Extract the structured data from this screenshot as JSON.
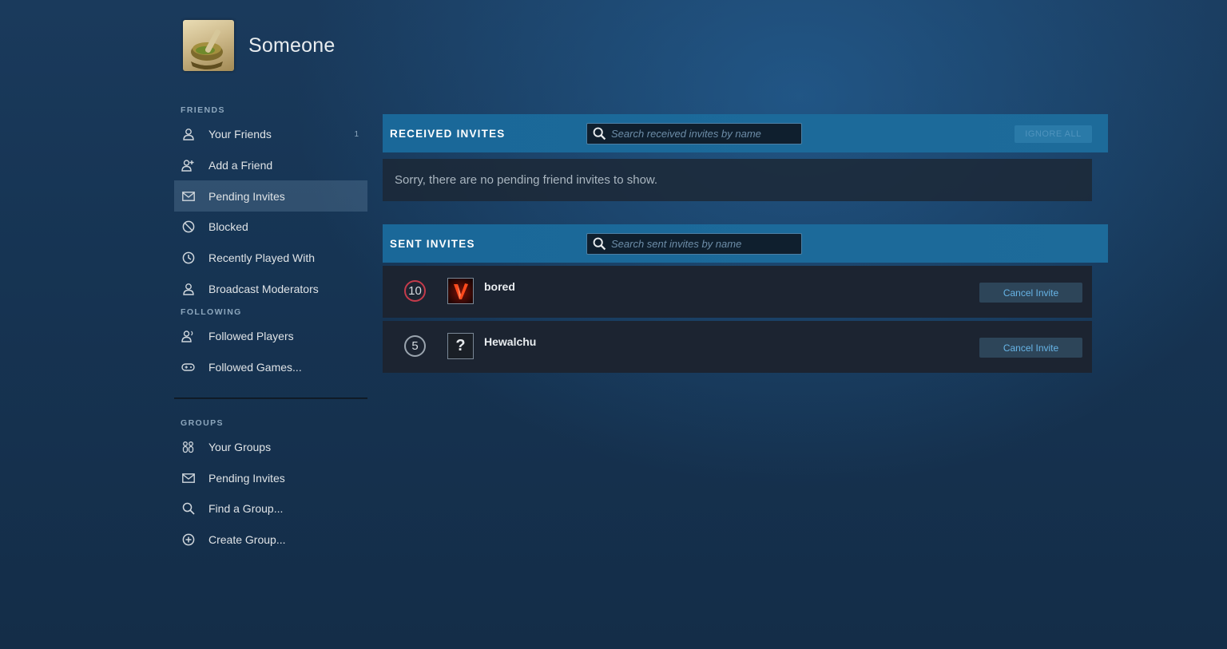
{
  "profile": {
    "name": "Someone",
    "avatar_icon": "mortar-pestle-avatar"
  },
  "sidebar": {
    "friends_title": "FRIENDS",
    "friends_items": [
      {
        "label": "Your Friends",
        "icon": "person-icon",
        "count": "1"
      },
      {
        "label": "Add a Friend",
        "icon": "person-add-icon"
      },
      {
        "label": "Pending Invites",
        "icon": "envelope-icon",
        "active": true
      },
      {
        "label": "Blocked",
        "icon": "blocked-icon"
      },
      {
        "label": "Recently Played With",
        "icon": "clock-icon"
      },
      {
        "label": "Broadcast Moderators",
        "icon": "person-icon"
      }
    ],
    "following_title": "FOLLOWING",
    "following_items": [
      {
        "label": "Followed Players",
        "icon": "person-follow-icon"
      },
      {
        "label": "Followed Games...",
        "icon": "gamepad-icon"
      }
    ],
    "groups_title": "GROUPS",
    "groups_items": [
      {
        "label": "Your Groups",
        "icon": "group-icon"
      },
      {
        "label": "Pending Invites",
        "icon": "envelope-icon"
      },
      {
        "label": "Find a Group...",
        "icon": "search-icon"
      },
      {
        "label": "Create Group...",
        "icon": "plus-circle-icon"
      }
    ]
  },
  "received": {
    "title": "RECEIVED INVITES",
    "search_placeholder": "Search received invites by name",
    "ignore_all_label": "IGNORE ALL",
    "empty_message": "Sorry, there are no pending friend invites to show."
  },
  "sent": {
    "title": "SENT INVITES",
    "search_placeholder": "Search sent invites by name",
    "invites": [
      {
        "level": "10",
        "name": "bored",
        "avatar": "v-logo-avatar",
        "cancel_label": "Cancel Invite"
      },
      {
        "level": "5",
        "name": "Hewalchu",
        "avatar": "question-mark-avatar",
        "avatar_text": "?",
        "cancel_label": "Cancel Invite"
      }
    ]
  },
  "colors": {
    "header_bar": "#1d6b9a",
    "active_item": "#4b6a86",
    "cancel_text": "#67b4e6",
    "level_10_ring": "#c43b4b"
  }
}
